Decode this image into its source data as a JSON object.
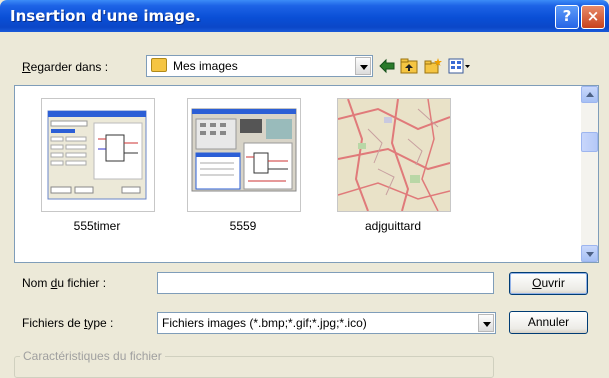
{
  "dialog": {
    "title": "Insertion d'une image.",
    "help_label": "?",
    "close_label": "×"
  },
  "look_in": {
    "label_prefix": "",
    "label_hotkey": "R",
    "label_rest": "egarder dans :",
    "value": "Mes images"
  },
  "toolbar": {
    "icons": [
      "back-arrow-icon",
      "up-folder-icon",
      "new-folder-icon",
      "view-menu-icon"
    ]
  },
  "files": [
    {
      "name": "555timer"
    },
    {
      "name": "5559"
    },
    {
      "name": "adjguittard"
    }
  ],
  "filename": {
    "label_prefix": "Nom ",
    "label_hotkey": "d",
    "label_rest": "u fichier :",
    "value": ""
  },
  "filetype": {
    "label_prefix": "Fichiers de ",
    "label_hotkey": "t",
    "label_rest": "ype :",
    "value": "Fichiers images (*.bmp;*.gif;*.jpg;*.ico)"
  },
  "buttons": {
    "open_hotkey": "O",
    "open_rest": "uvrir",
    "cancel": "Annuler"
  },
  "properties_group": {
    "label": "Caractéristiques du fichier"
  },
  "colors": {
    "titlebar": "#0a4fd6",
    "dialog_bg": "#ece9d8",
    "accent_arrow": "#2a7a2a"
  }
}
